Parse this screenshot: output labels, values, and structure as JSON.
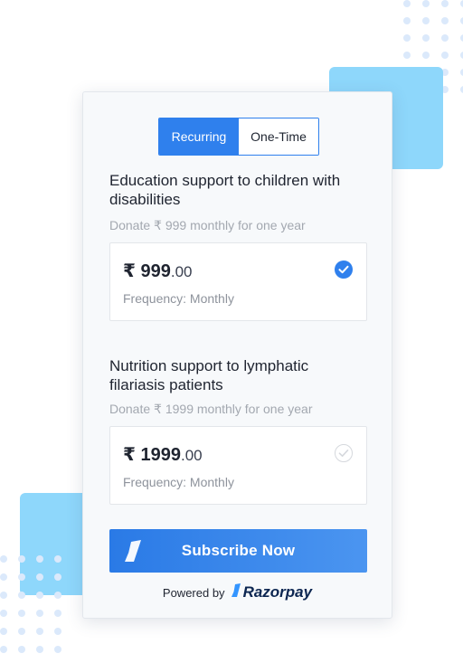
{
  "toggle": {
    "recurring_label": "Recurring",
    "onetime_label": "One-Time",
    "selected": "Recurring"
  },
  "plans": [
    {
      "title": "Education support to children with disabilities",
      "subtitle": "Donate ₹ 999 monthly for one year",
      "amount_main": "₹ 999",
      "amount_cents": ".00",
      "frequency": "Frequency: Monthly",
      "selected": true
    },
    {
      "title": "Nutrition support to lymphatic filariasis patients",
      "subtitle": "Donate ₹ 1999 monthly for one year",
      "amount_main": "₹ 1999",
      "amount_cents": ".00",
      "frequency": "Frequency: Monthly",
      "selected": false
    }
  ],
  "subscribe": {
    "label": "Subscribe Now",
    "icon": "razorpay-logo-icon"
  },
  "footer": {
    "powered_by": "Powered by",
    "brand": "Razorpay",
    "brand_icon": "razorpay-logo-icon"
  },
  "colors": {
    "accent": "#2f80ed",
    "decor_blue": "#8ed7fb",
    "dot": "#dbe9fb",
    "brand_navy": "#0c2651"
  }
}
